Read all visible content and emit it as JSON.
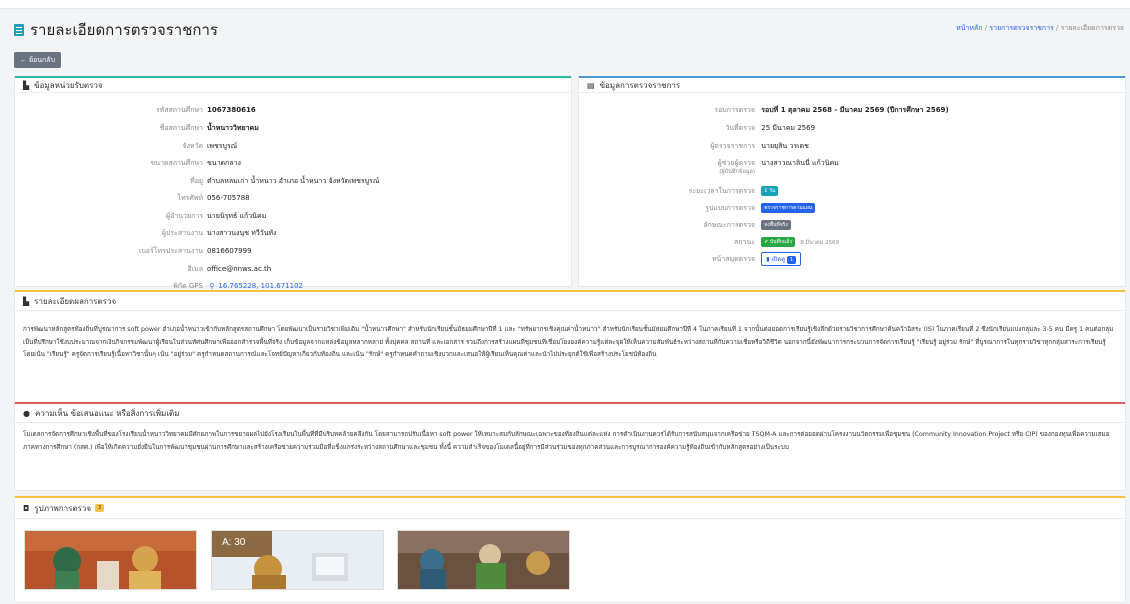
{
  "header": {
    "title": "รายละเอียดการตรวจราชการ",
    "breadcrumb_home": "หน้าหลัก",
    "breadcrumb_sep1": " / ",
    "breadcrumb_list": "รายการตรวจราชการ",
    "breadcrumb_sep2": " / ",
    "breadcrumb_current": "รายละเอียดการตรวจ"
  },
  "back_button": "← ย้อนกลับ",
  "school_card": {
    "title": "ข้อมูลหน่วยรับตรวจ",
    "rows": [
      {
        "label": "รหัสสถานศึกษา",
        "value": "1067380616"
      },
      {
        "label": "ชื่อสถานศึกษา",
        "value": "น้ำหนาววิทยาคม"
      },
      {
        "label": "จังหวัด",
        "value": "เพชรบูรณ์"
      },
      {
        "label": "ขนาดสถานศึกษา",
        "value": "ขนาดกลาง"
      },
      {
        "label": "ที่อยู่",
        "value": "ตำบลหลมเก่า น้ำหนาว อำเภอ น้ำหนาว จังหวัดเพชรบูรณ์"
      },
      {
        "label": "โทรศัพท์",
        "value": "056-705788"
      },
      {
        "label": "ผู้อำนวยการ",
        "value": "นายนิรุทธ์ แก้วนิคม"
      },
      {
        "label": "ผู้ประสานงาน",
        "value": "นางสาวนงนุช ทวีวันทัง"
      },
      {
        "label": "เบอร์โทรประสานงาน",
        "value": "0816607999"
      },
      {
        "label": "อีเมล",
        "value": "office@nnws.ac.th"
      },
      {
        "label": "พิกัด GPS",
        "value": "16.765228, 101.671102"
      }
    ]
  },
  "inspection_card": {
    "title": "ข้อมูลการตรวจราชการ",
    "round_label": "รอบการตรวจ",
    "round_value": "รอบที่ 1 ตุลาคม 2568 - มีนาคม 2569 (ปีการศึกษา 2569)",
    "date_label": "วันที่ตรวจ",
    "date_value": "25 มีนาคม 2569",
    "inspector_label": "ผู้ตรวจราชการ",
    "inspector_value": "นายยุสิน วรเดช",
    "assistant_label": "ผู้ช่วยผู้ตรวจ",
    "assistant_sub": "(ผู้บันทึกข้อมูล)",
    "assistant_value": "นางสาวณาลินนี่ แก้วนิคม",
    "duration_label": "ระยะเวลาในการตรวจ",
    "duration_value": "1 วัน",
    "format_label": "รูปแบบการตรวจ",
    "format_value": "ตรวจราชการตามแผน",
    "type_label": "ลักษณะการตรวจ",
    "type_value": "ลงพื้นที่จริง",
    "status_label": "สถานะ",
    "status_value": "✔ บันทึกแล้ว",
    "status_date": "8 มีนาคม 2569",
    "doc_label": "หน้าสมุดตรวจ",
    "doc_value": "เปิดดู",
    "doc_count": "1"
  },
  "result_card": {
    "title": "รายละเอียดผลการตรวจ",
    "text": "การพัฒนาหลักสูตรท้องถิ่นที่บูรณาการ soft power อำเภอน้ำหนาวเข้ากับหลักสูตรสถานศึกษา โดยพัฒนาเป็นรายวิชาเพิ่มเติม \"น้ำหนาวศึกษา\" สำหรับนักเรียนชั้นมัธยมศึกษาปีที่ 1 และ \"ทรัพยากรเชิงคุณค่าน้ำหนาว\" สำหรับนักเรียนชั้นมัธยมศึกษาปีที่ 4 ในภาคเรียนที่ 1 จากนั้นต่อยอดการเรียนรู้เชิงลึกด้วยรายวิชาการศึกษาค้นคว้าอิสระ (IS) ในภาคเรียนที่ 2 ซึ่งนักเรียนแบ่งกลุ่มละ 3-5 คน มีครู 1 คนต่อกลุ่มเป็นที่ปรึกษาใช้งบประมาณจากเงินกิจกรรมพัฒนาผู้เรียนในส่วนทัศนศึกษาเพื่อออกสำรวจพื้นที่จริง เก็บข้อมูลจากแหล่งข้อมูลหลากหลาย ทั้งบุคคล สถานที่ และเอกสาร รวมถึงการสร้างแผนที่ชุมชนที่เชื่อมโยงองค์ความรู้แต่ละจุดให้เห็นความสัมพันธ์ระหว่างสถานที่กับความเชื่อหรือวิถีชีวิต นอกจากนี้ยังพัฒนาการกระบวนการจัดการเรียนรู้ \"เรียนรู้ อยู่ร่วม รักษ์\" ที่บูรณาการในทุกรายวิชาทุกกลุ่มสาระการเรียนรู้ โดยเน้น \"เรียนรู้\" ครูจัดการเรียนรู้เนื้อหาวิชานั้นๆ เน้น \"อยู่ร่วม\" ครูกำหนดสถานการณ์และโจทย์ปัญหาเกี่ยวกับท้องถิ่น และเน้น \"รักษ์\" ครูกำหนดคำถามเชิงบวกและเสนอให้ผู้เรียนเห็นคุณค่าและนำไปประยุกต์ใช้เพื่อสร้างประโยชน์ท้องถิ่น"
  },
  "comment_card": {
    "title": "ความเห็น ข้อเสนอแนะ หรือสิ่งการเพิ่มเติม",
    "text": "โมเดลการจัดการศึกษาเชิงพื้นที่ของโรงเรียนน้ำหนาววิทยาคมมีศักยภาพในการขยายผลไปยังโรงเรียนในพื้นที่ที่มีบริบทคล้ายคลึงกัน โดยสามารถปรับเนื้อหา soft power ให้เหมาะสมกับลักษณะเฉพาะของท้องถิ่นแต่ละแห่ง การดำเนินงานควรได้รับการสนับสนุนจากเครือข่าย TSQM-A และการต่อยอดผ่านโครงงานนวัตกรรมเพื่อชุมชน (Community Innovation Project หรือ CIP) ของกองทุนเพื่อความเสมอภาคทางการศึกษา (กสศ.) เพื่อให้เกิดความยั่งยืนในการพัฒนาชุมชนผ่านการศึกษาและสร้างเครือข่ายความร่วมมือที่แข็งแกร่งระหว่างสถานศึกษาและชุมชน ทั้งนี้ ความสำเร็จของโมเดลนี้อยู่ที่การมีส่วนร่วมของทุกภาคส่วนและการบูรณาการองค์ความรู้ท้องถิ่นเข้ากับหลักสูตรอย่างเป็นระบบ"
  },
  "photos_card": {
    "title": "รูปภาพการตรวจ",
    "count": "3",
    "photo_text": "A: 30"
  },
  "colors": {
    "accent": "#1fa0b5",
    "school_border": "#2bb6a7",
    "inspect_border": "#4a9ad8",
    "result_border": "#f6c344",
    "comment_border": "#e05a5a",
    "photo_border": "#f6c344",
    "link": "#2563eb"
  },
  "icons": {
    "title": "list-icon",
    "school": "building-icon",
    "inspection": "clipboard-icon",
    "result": "file-icon",
    "comment": "comment-icon",
    "photos": "camera-icon",
    "gps": "map-pin-icon",
    "doc": "book-icon"
  }
}
